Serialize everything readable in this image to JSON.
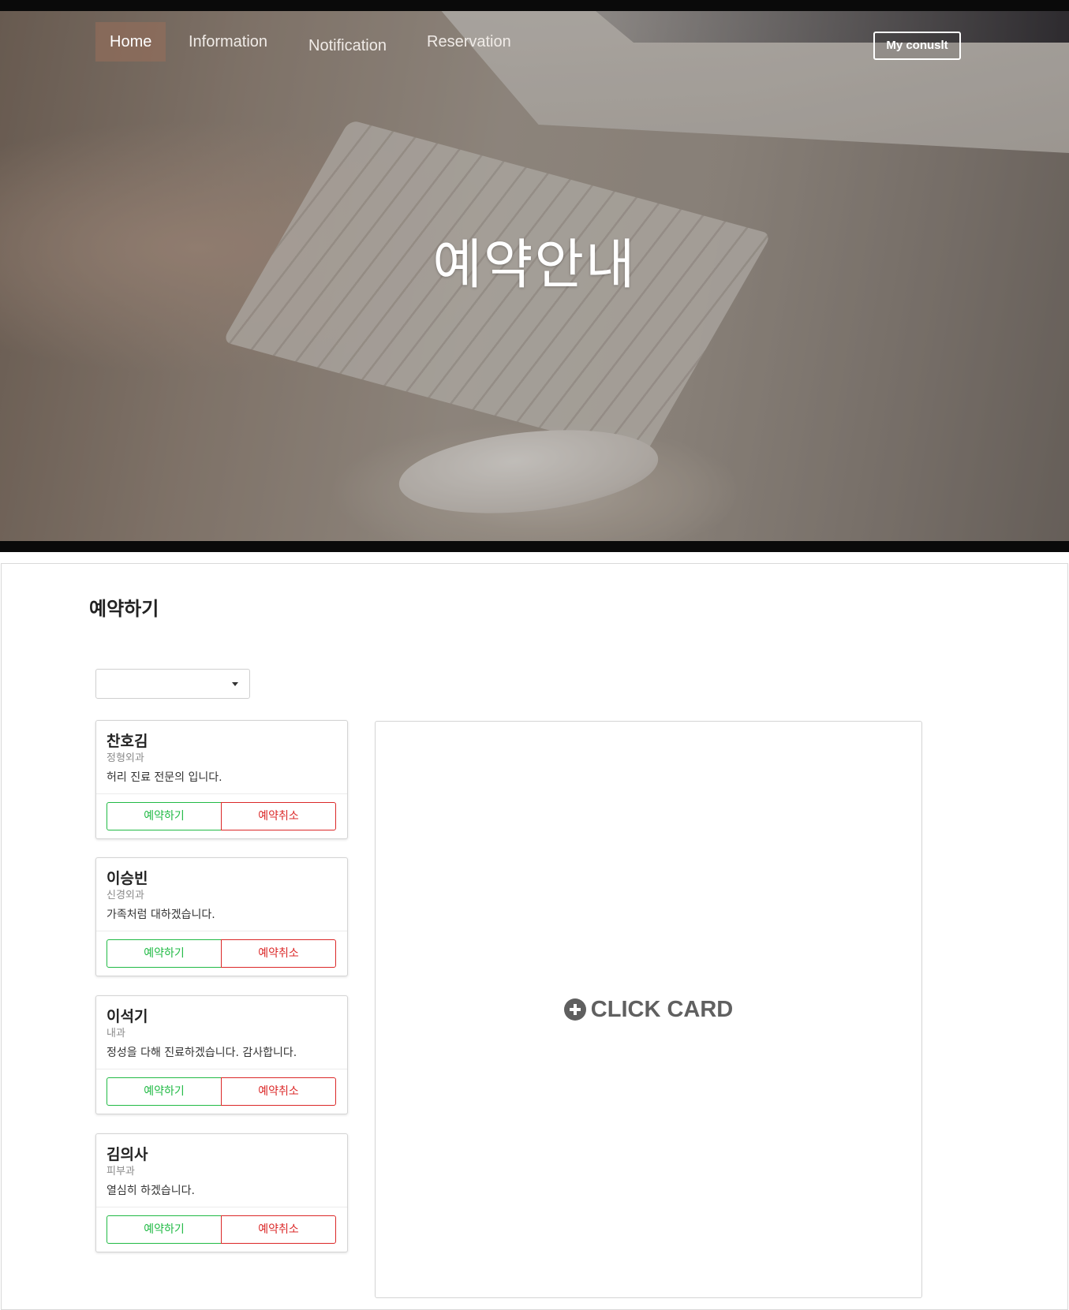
{
  "nav": {
    "items": [
      {
        "label": "Home"
      },
      {
        "label": "Information"
      },
      {
        "label": "Notification"
      },
      {
        "label": "Reservation"
      }
    ],
    "active": "Home",
    "consult_label": "My conuslt"
  },
  "hero": {
    "title": "예약안내"
  },
  "section": {
    "title": "예약하기"
  },
  "select": {
    "value": ""
  },
  "doctors": [
    {
      "name": "찬호김",
      "department": "정형외과",
      "description": "허리 진료 전문의 입니다.",
      "reserve_label": "예약하기",
      "cancel_label": "예약취소"
    },
    {
      "name": "이승빈",
      "department": "신경외과",
      "description": "가족처럼 대하겠습니다.",
      "reserve_label": "예약하기",
      "cancel_label": "예약취소"
    },
    {
      "name": "이석기",
      "department": "내과",
      "description": "정성을 다해 진료하겠습니다. 감사합니다.",
      "reserve_label": "예약하기",
      "cancel_label": "예약취소"
    },
    {
      "name": "김의사",
      "department": "피부과",
      "description": "열심히 하겠습니다.",
      "reserve_label": "예약하기",
      "cancel_label": "예약취소"
    }
  ],
  "detail": {
    "placeholder": "CLICK CARD",
    "icon": "plus-circle-icon"
  },
  "colors": {
    "reserve": "#21ba45",
    "cancel": "#db2828",
    "click_text": "#606060"
  }
}
